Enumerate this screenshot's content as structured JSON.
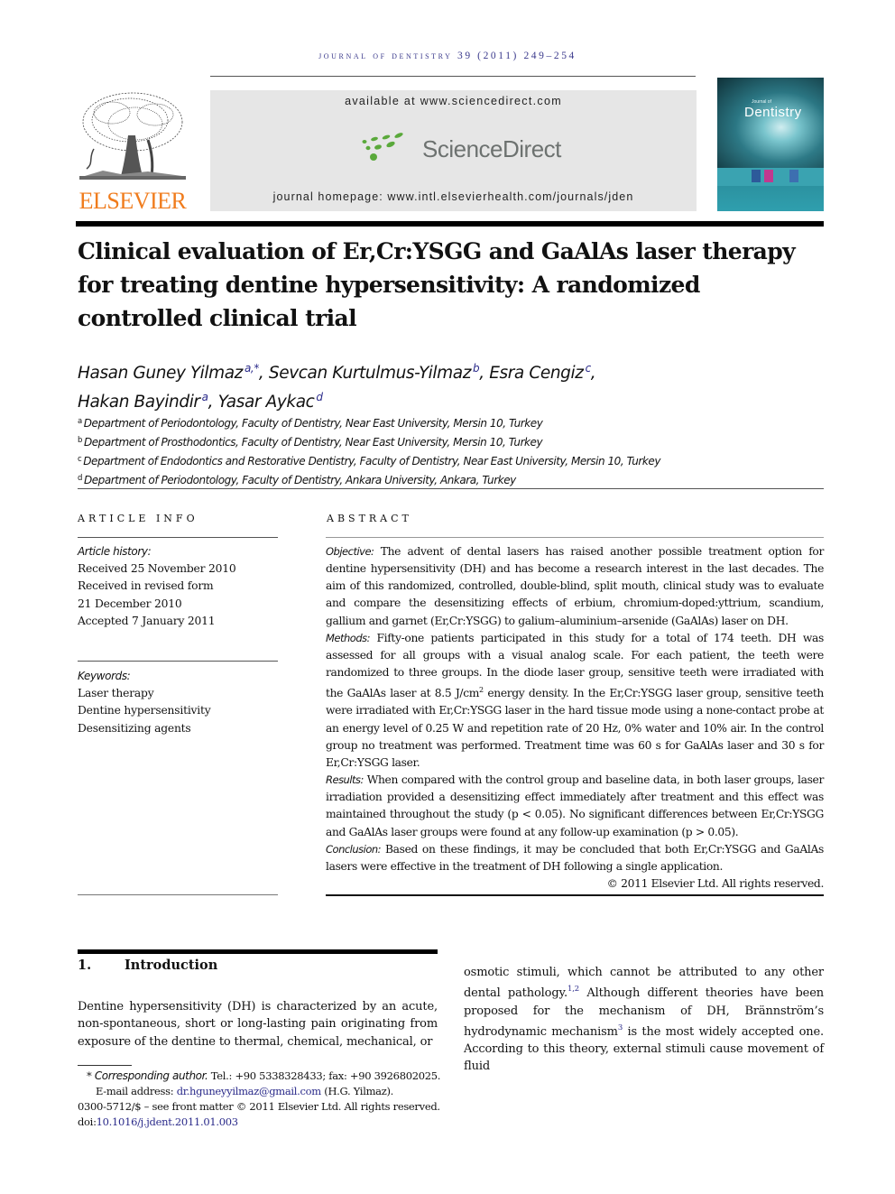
{
  "running_head": "JOURNAL OF DENTISTRY 39 (2011) 249–254",
  "header": {
    "publisher_logo_text": "ELSEVIER",
    "available_at": "available at www.sciencedirect.com",
    "sciencedirect_label": "ScienceDirect",
    "journal_homepage": "journal homepage: www.intl.elsevierhealth.com/journals/jden",
    "cover_title": "Dentistry",
    "cover_subtitle": "Journal of",
    "colors": {
      "elsevier_orange": "#f07c1d",
      "sciencedirect_green": "#5aa93b",
      "sciencedirect_gray": "#6d7270",
      "link_blue": "#2a2a8a",
      "cover_teal": "#2f9fae"
    }
  },
  "article": {
    "title_lines": [
      "Clinical evaluation of Er,Cr:YSGG and GaAlAs laser therapy",
      "for treating dentine hypersensitivity: A randomized",
      "controlled clinical trial"
    ],
    "authors": [
      {
        "name": "Hasan Guney Yilmaz",
        "sup": "a,*"
      },
      {
        "name": "Sevcan Kurtulmus-Yilmaz",
        "sup": "b"
      },
      {
        "name": "Esra Cengiz",
        "sup": "c"
      },
      {
        "name": "Hakan Bayindir",
        "sup": "a"
      },
      {
        "name": "Yasar Aykac",
        "sup": "d"
      }
    ],
    "affiliations": [
      {
        "key": "a",
        "text": "Department of Periodontology, Faculty of Dentistry, Near East University, Mersin 10, Turkey"
      },
      {
        "key": "b",
        "text": "Department of Prosthodontics, Faculty of Dentistry, Near East University, Mersin 10, Turkey"
      },
      {
        "key": "c",
        "text": "Department of Endodontics and Restorative Dentistry, Faculty of Dentistry, Near East University, Mersin 10, Turkey"
      },
      {
        "key": "d",
        "text": "Department of Periodontology, Faculty of Dentistry, Ankara University, Ankara, Turkey"
      }
    ]
  },
  "article_info": {
    "heading": "ARTICLE INFO",
    "history_label": "Article history:",
    "history": [
      "Received 25 November 2010",
      "Received in revised form",
      "21 December 2010",
      "Accepted 7 January 2011"
    ],
    "keywords_label": "Keywords:",
    "keywords": [
      "Laser therapy",
      "Dentine hypersensitivity",
      "Desensitizing agents"
    ]
  },
  "abstract": {
    "heading": "ABSTRACT",
    "objective_label": "Objective:",
    "objective": "The advent of dental lasers has raised another possible treatment option for dentine hypersensitivity (DH) and has become a research interest in the last decades. The aim of this randomized, controlled, double-blind, split mouth, clinical study was to evaluate and compare the desensitizing effects of erbium, chromium-doped:yttrium, scandium, gallium and garnet (Er,Cr:YSGG) to galium–aluminium–arsenide (GaAlAs) laser on DH.",
    "methods_label": "Methods:",
    "methods_part1": "Fifty-one patients participated in this study for a total of 174 teeth. DH was assessed for all groups with a visual analog scale. For each patient, the teeth were randomized to three groups. In the diode laser group, sensitive teeth were irradiated with the GaAlAs laser at 8.5 J/cm",
    "methods_sup": "2",
    "methods_part2": " energy density. In the Er,Cr:YSGG laser group, sensitive teeth were irradiated with Er,Cr:YSGG laser in the hard tissue mode using a none-contact probe at an energy level of 0.25 W and repetition rate of 20 Hz, 0% water and 10% air. In the control group no treatment was performed. Treatment time was 60 s for GaAlAs laser and 30 s for Er,Cr:YSGG laser.",
    "results_label": "Results:",
    "results": "When compared with the control group and baseline data, in both laser groups, laser irradiation provided a desensitizing effect immediately after treatment and this effect was maintained throughout the study (p < 0.05). No significant differences between Er,Cr:YSGG and GaAlAs laser groups were found at any follow-up examination (p > 0.05).",
    "conclusion_label": "Conclusion:",
    "conclusion": "Based on these findings, it may be concluded that both Er,Cr:YSGG and GaAlAs lasers were effective in the treatment of DH following a single application.",
    "copyright": "© 2011 Elsevier Ltd. All rights reserved."
  },
  "introduction": {
    "number": "1.",
    "heading": "Introduction",
    "left_text": "Dentine hypersensitivity (DH) is characterized by an acute, non-spontaneous, short or long-lasting pain originating from exposure of the dentine to thermal, chemical, mechanical, or",
    "right_part1": "osmotic stimuli, which cannot be attributed to any other dental pathology.",
    "right_ref1": "1,2",
    "right_part2": " Although different theories have been proposed for the mechanism of DH, Brännström’s hydrodynamic mechanism",
    "right_ref2": "3",
    "right_part3": " is the most widely accepted one. According to this theory, external stimuli cause movement of fluid"
  },
  "footnotes": {
    "corresponding_marker": "*",
    "corresponding_label": "Corresponding author.",
    "corresponding_text": " Tel.: +90 5338328433; fax: +90 3926802025.",
    "email_label": "E-mail address: ",
    "email": "dr.hguneyyilmaz@gmail.com",
    "email_suffix": " (H.G. Yilmaz).",
    "issn_line": "0300-5712/$ – see front matter © 2011 Elsevier Ltd. All rights reserved.",
    "doi_label": "doi:",
    "doi": "10.1016/j.jdent.2011.01.003"
  }
}
